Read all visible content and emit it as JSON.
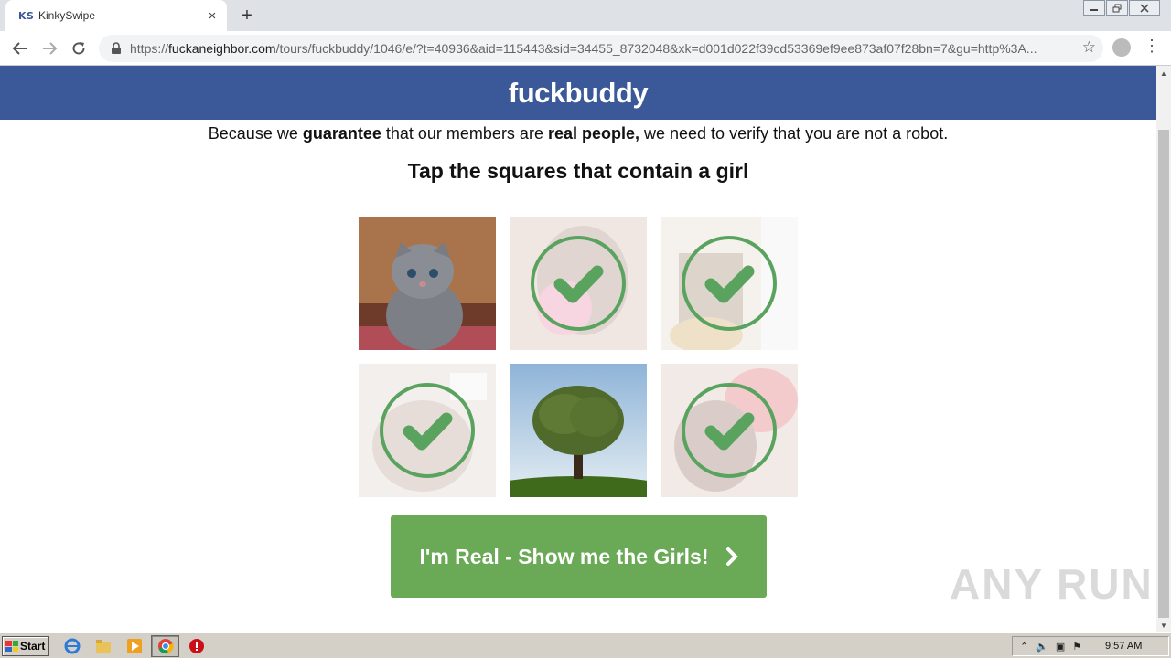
{
  "browser": {
    "tab": {
      "favicon": "KS",
      "title": "KinkySwipe",
      "close": "×"
    },
    "newtab": "+",
    "url": {
      "scheme": "https://",
      "host": "fuckaneighbor.com",
      "path": "/tours/fuckbuddy/1046/e/?t=40936&aid=115443&sid=34455_8732048&xk=d001d022f39cd53369ef9ee873af07f28bn=7&gu=http%3A..."
    },
    "window_controls": [
      "minimize",
      "restore",
      "close"
    ]
  },
  "page": {
    "brand": "fuckbuddy",
    "intro": {
      "p1": "Because we ",
      "b1": "guarantee",
      "p2": " that our members are ",
      "b2": "real people,",
      "p3": " we need to verify that you are not a robot."
    },
    "heading": "Tap the squares that contain a girl",
    "tiles": [
      {
        "subject": "kitten",
        "selected": false
      },
      {
        "subject": "girl",
        "selected": true
      },
      {
        "subject": "girl",
        "selected": true
      },
      {
        "subject": "girl",
        "selected": true
      },
      {
        "subject": "tree",
        "selected": false
      },
      {
        "subject": "girl",
        "selected": true
      }
    ],
    "cta_label": "I'm Real - Show me the Girls!",
    "watermark": "ANY RUN"
  },
  "taskbar": {
    "start_label": "Start",
    "clock": "9:57 AM",
    "icons": [
      "ie-icon",
      "explorer-icon",
      "media-player-icon",
      "chrome-icon",
      "opera-icon"
    ]
  },
  "colors": {
    "header": "#3b5998",
    "cta": "#6aaa57",
    "check": "#5aa35f"
  }
}
